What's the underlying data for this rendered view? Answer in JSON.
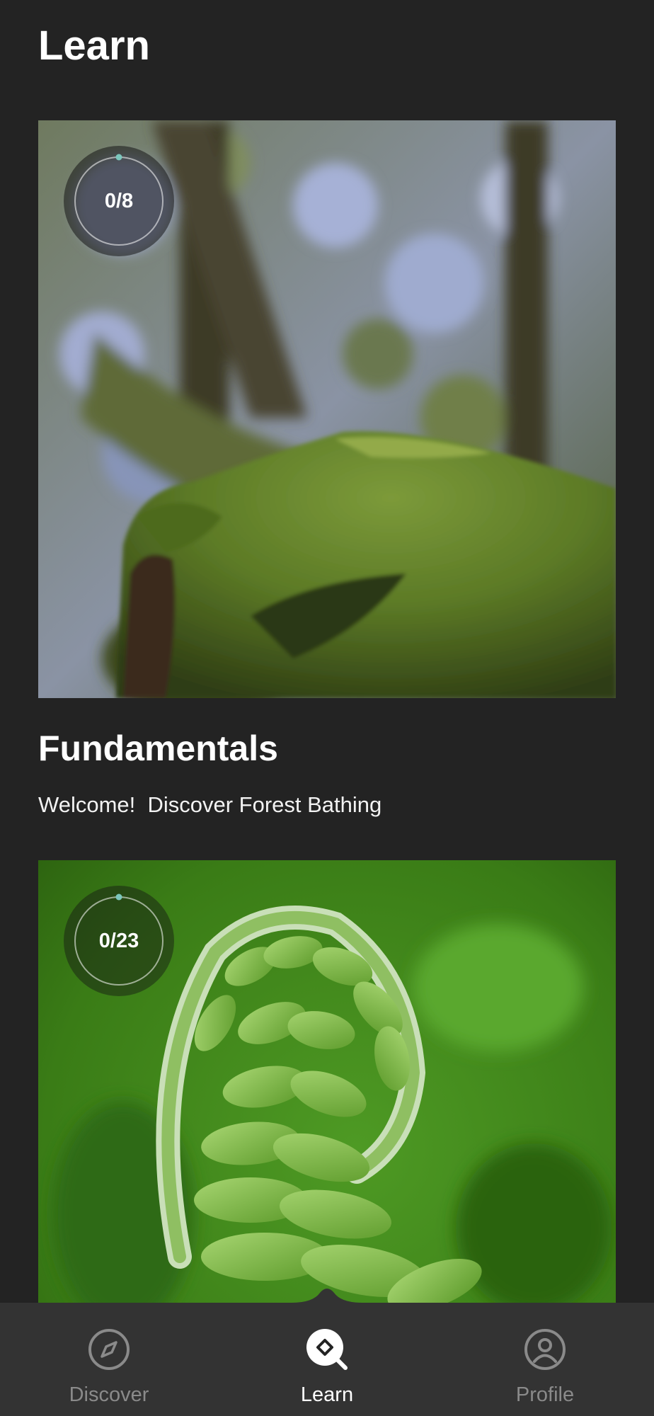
{
  "header": {
    "title": "Learn"
  },
  "courses": [
    {
      "progress_text": "0/8",
      "progress_completed": 0,
      "progress_total": 8,
      "title": "Fundamentals",
      "subtitle": "Welcome!  Discover Forest Bathing",
      "image_icon": "moss-log-photo"
    },
    {
      "progress_text": "0/23",
      "progress_completed": 0,
      "progress_total": 23,
      "image_icon": "fern-fiddlehead-photo"
    }
  ],
  "bottom_nav": {
    "items": [
      {
        "label": "Discover",
        "icon": "compass-icon",
        "active": false
      },
      {
        "label": "Learn",
        "icon": "learn-search-icon",
        "active": true
      },
      {
        "label": "Profile",
        "icon": "user-icon",
        "active": false
      }
    ]
  },
  "colors": {
    "background": "#232323",
    "nav_background": "#333333",
    "progress_accent": "#7cc7bd",
    "inactive_nav": "#8a8a8a"
  }
}
